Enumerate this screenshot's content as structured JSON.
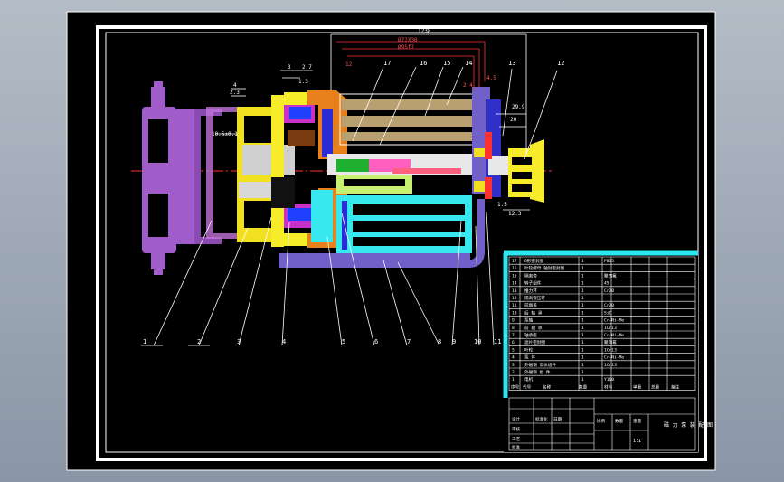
{
  "callouts": [
    "1",
    "2",
    "3",
    "4",
    "5",
    "6",
    "7",
    "8",
    "9",
    "10",
    "11",
    "12",
    "13",
    "14",
    "15",
    "16",
    "17"
  ],
  "dims": {
    "top": "1238",
    "r1": "Ø72X30",
    "r2": "Ø95f7",
    "a": "12",
    "b": "3",
    "c": "2.7",
    "d": "1.3",
    "e": "4",
    "f": "2.3",
    "g": "10.5±0.1",
    "h": "2.4",
    "i": "4.5",
    "j": "29.9",
    "k": "20",
    "l": "12.3",
    "m": "1.5"
  },
  "table": {
    "rows": [
      [
        "17",
        "O形密封圈",
        "1",
        "F015"
      ],
      [
        "16",
        "叶轮螺母 轴封密封圈",
        "1",
        ""
      ],
      [
        "15",
        "隔离套",
        "1",
        "聚四氟"
      ],
      [
        "14",
        "转子组件",
        "1",
        "45"
      ],
      [
        "13",
        "推力环",
        "1",
        "Cr20"
      ],
      [
        "12",
        "隔离套压环",
        "1",
        ""
      ],
      [
        "11",
        "前端盖",
        "1",
        "Cr20"
      ],
      [
        "10",
        "后 轴 承",
        "1",
        "SiC"
      ],
      [
        "9",
        "泵轴",
        "1",
        "Cr-Ni-Mo"
      ],
      [
        "8",
        "前 轴 承",
        "1",
        "1Cr13"
      ],
      [
        "7",
        "轴承座",
        "1",
        "Cr-Ni-Mo"
      ],
      [
        "6",
        "滤片密封圈",
        "1",
        "聚四氟"
      ],
      [
        "5",
        "叶轮",
        "1",
        "1Cr13"
      ],
      [
        "4",
        "泵 体",
        "1",
        "Cr-Ni-Mo"
      ],
      [
        "3",
        "外磁钢 泵体组件",
        "1",
        "1Cr13"
      ],
      [
        "2",
        "外磁钢 组 件",
        "1",
        ""
      ],
      [
        "1",
        "电机",
        "1",
        "Y160"
      ]
    ],
    "header": [
      "序号",
      "代号",
      "名称",
      "数量",
      "材料",
      "单重",
      "总重",
      "备注"
    ],
    "title_drawing": "磁 力 泵 装 配 图",
    "scale": "1:1",
    "labels": [
      "设计",
      "审核",
      "工艺",
      "批准",
      "标准化",
      "日期",
      "比例",
      "数量",
      "重量"
    ]
  }
}
